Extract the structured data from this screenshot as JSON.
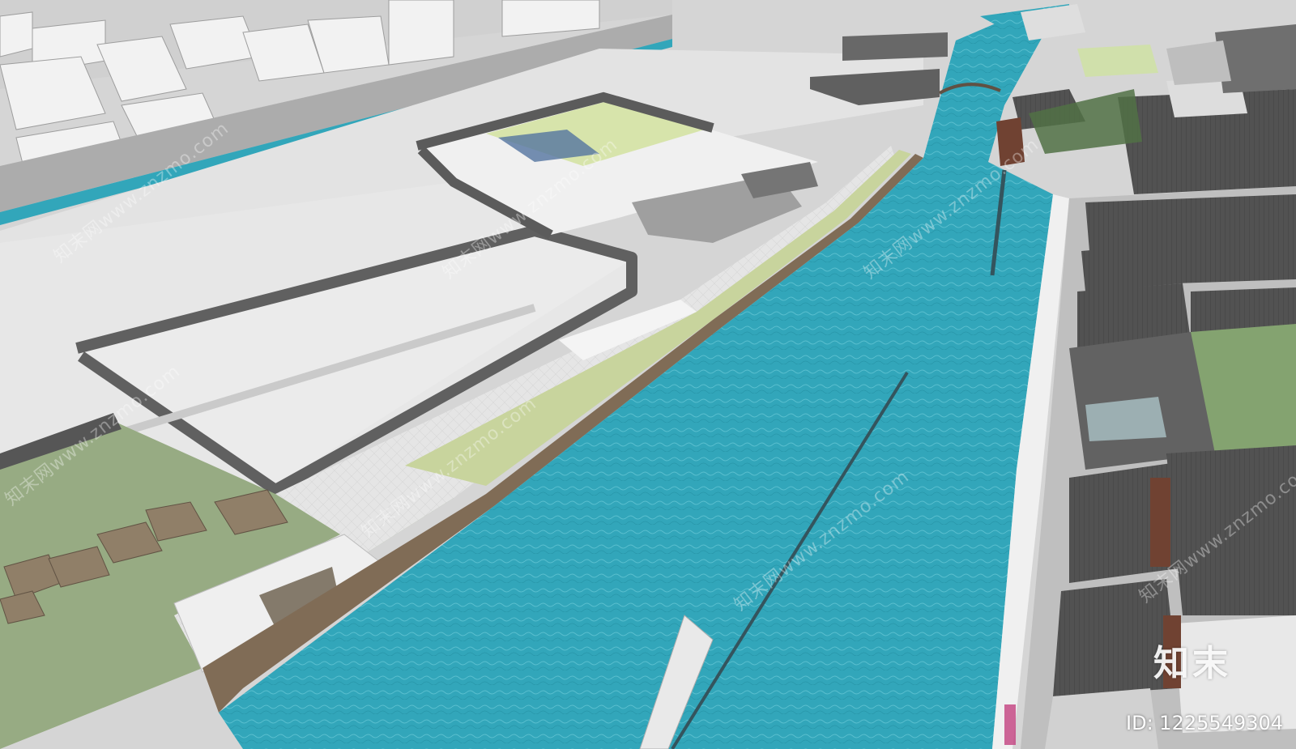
{
  "scene": {
    "description_type": "3D SketchUp model render of a riverside landscape with traditional buildings",
    "colors": {
      "water": "#2aa3b8",
      "water_dark": "#1d8ea3",
      "grass": "#93a87e",
      "grass_light": "#c9d6a4",
      "paving": "#e6e6e6",
      "roof": "#4a4a4a",
      "wall": "#5a5a5a",
      "timber": "#6b3b2a"
    }
  },
  "watermark": {
    "diagonal_text": "知末网www.znzmo.com",
    "logo_text": "知末",
    "id_text": "ID: 1225549304"
  }
}
